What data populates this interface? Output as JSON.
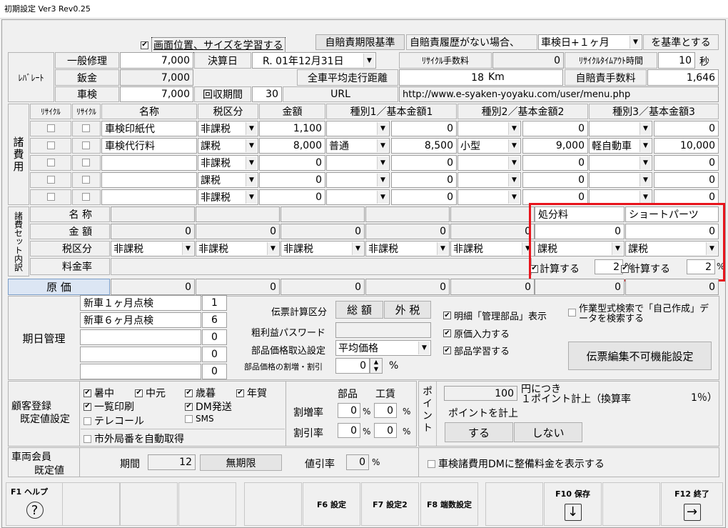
{
  "window": {
    "title": "初期設定 Ver3 Rev0.25"
  },
  "top": {
    "learn_checkbox": "画面位置、サイズを学習する",
    "jibai_label": "自賠責期限基準",
    "jibai_cond": "自賠責履歴がない場合、",
    "jibai_select": "車検日+１ヶ月",
    "jibai_suffix": "を基準とする"
  },
  "rate": {
    "section_label": "ﾚﾊﾞﾚｰﾄ",
    "rows": [
      {
        "label": "一般修理",
        "value": "7,000"
      },
      {
        "label": "鈑金",
        "value": "7,000"
      },
      {
        "label": "車検",
        "value": "7,000"
      }
    ],
    "kessan_label": "決算日",
    "kessan_value": "R. 01年12月31日",
    "kaishu_label": "回収期間",
    "kaishu_value": "30",
    "recycle_fee_label": "ﾘｻｲｸﾙ手数料",
    "recycle_fee_value": "0",
    "recycle_timeout_label": "ﾘｻｲｸﾙﾀｲﾑｱｳﾄ時間",
    "recycle_timeout_value": "10",
    "recycle_timeout_unit": "秒",
    "avg_label": "全車平均走行距離",
    "avg_value": "18",
    "avg_unit": "Km",
    "jibai_fee_label": "自賠責手数料",
    "jibai_fee_value": "1,646",
    "url_label": "URL",
    "url_value": "http://www.e-syaken-yoyaku.com/user/menu.php"
  },
  "fees": {
    "section_label": "諸費用",
    "headers": [
      "ﾘｻｲｸﾙ",
      "ﾘｻｲｸﾙ",
      "名称",
      "税区分",
      "金額",
      "種別1／基本金額1",
      "種別2／基本金額2",
      "種別3／基本金額3"
    ],
    "rows": [
      {
        "name": "車検印紙代",
        "tax": "非課税",
        "amount": "1,100",
        "t1": "",
        "a1": "0",
        "t2": "",
        "a2": "0",
        "t3": "",
        "a3": "0"
      },
      {
        "name": "車検代行料",
        "tax": "課税",
        "amount": "8,000",
        "t1": "普通",
        "a1": "8,500",
        "t2": "小型",
        "a2": "9,000",
        "t3": "軽自動車",
        "a3": "10,000"
      },
      {
        "name": "",
        "tax": "非課税",
        "amount": "0",
        "t1": "",
        "a1": "0",
        "t2": "",
        "a2": "0",
        "t3": "",
        "a3": "0"
      },
      {
        "name": "",
        "tax": "課税",
        "amount": "0",
        "t1": "",
        "a1": "0",
        "t2": "",
        "a2": "0",
        "t3": "",
        "a3": "0"
      },
      {
        "name": "",
        "tax": "非課税",
        "amount": "0",
        "t1": "",
        "a1": "0",
        "t2": "",
        "a2": "0",
        "t3": "",
        "a3": "0"
      }
    ]
  },
  "set": {
    "section_label": "諸費セット内訳",
    "name_label": "名 称",
    "amount_label": "金 額",
    "tax_label": "税区分",
    "rate_label": "料金率",
    "cols": [
      {
        "name": "",
        "amount": "0",
        "tax": "非課税"
      },
      {
        "name": "",
        "amount": "0",
        "tax": "非課税"
      },
      {
        "name": "",
        "amount": "0",
        "tax": "非課税"
      },
      {
        "name": "",
        "amount": "0",
        "tax": "非課税"
      },
      {
        "name": "",
        "amount": "0",
        "tax": "非課税"
      },
      {
        "name": "処分料",
        "amount": "0",
        "tax": "課税",
        "calc": "計算する",
        "rate": "2"
      },
      {
        "name": "ショートパーツ",
        "amount": "0",
        "tax": "課税",
        "calc": "計算する",
        "rate": "2"
      }
    ],
    "pct": "%"
  },
  "cost": {
    "label": "原 価",
    "values": [
      "0",
      "0",
      "0",
      "0",
      "0",
      "0",
      "0"
    ]
  },
  "schedule": {
    "label": "期日管理",
    "items": [
      {
        "name": "新車１ヶ月点検",
        "value": "1"
      },
      {
        "name": "新車６ヶ月点検",
        "value": "6"
      },
      {
        "name": "",
        "value": "0"
      },
      {
        "name": "",
        "value": "0"
      },
      {
        "name": "",
        "value": "0"
      }
    ],
    "calc_label": "伝票計算区分",
    "calc_opt1": "総 額",
    "calc_opt2": "外 税",
    "pw_label": "粗利益パスワード",
    "price_label": "部品価格取込設定",
    "price_value": "平均価格",
    "adj_label": "部品価格の割増・割引",
    "adj_value": "0",
    "adj_unit": "%",
    "chk1": "明細「管理部品」表示",
    "chk2": "原価入力する",
    "chk3": "部品学習する",
    "chk4": "作業型式検索で「自己作成」データを検索する",
    "edit_button": "伝票編集不可機能設定"
  },
  "customer": {
    "label1": "顧客登録",
    "label2": "既定値設定",
    "chk": [
      "暑中",
      "中元",
      "歳暮",
      "年賀",
      "一覧印刷",
      "DM発送",
      "テレコール",
      "SMS",
      "市外局番を自動取得"
    ],
    "part_label": "部品",
    "labor_label": "工賃",
    "markup_label": "割増率",
    "discount_label": "割引率",
    "markup_part": "0",
    "markup_labor": "0",
    "discount_part": "0",
    "discount_labor": "0",
    "pct": "%"
  },
  "point": {
    "label": "ポイント",
    "value": "100",
    "per": "円につき",
    "unit": "１ポイント計上（換算率",
    "rate": "1％）",
    "label2": "ポイントを計上",
    "yes": "する",
    "no": "しない"
  },
  "member": {
    "label1": "車両会員",
    "label2": "既定値",
    "period_label": "期間",
    "period_value": "12",
    "unlimited": "無期限",
    "disc_label": "値引率",
    "disc_value": "0",
    "pct": "%",
    "dm_check": "車検諸費用DMに整備料金を表示する"
  },
  "fkeys": [
    {
      "label": "F1 ヘルプ",
      "icon": "help-icon"
    },
    {
      "label": ""
    },
    {
      "label": ""
    },
    {
      "label": ""
    },
    {
      "label": ""
    },
    {
      "label": "F6 設定"
    },
    {
      "label": "F7 設定2"
    },
    {
      "label": "F8 端数設定"
    },
    {
      "label": ""
    },
    {
      "label": "F10 保存",
      "icon": "save-icon"
    },
    {
      "label": ""
    },
    {
      "label": "F12 終了",
      "icon": "exit-icon"
    }
  ],
  "colors": {
    "highlight": "#e8141c",
    "cost_label_bg": "#dce6f4"
  }
}
